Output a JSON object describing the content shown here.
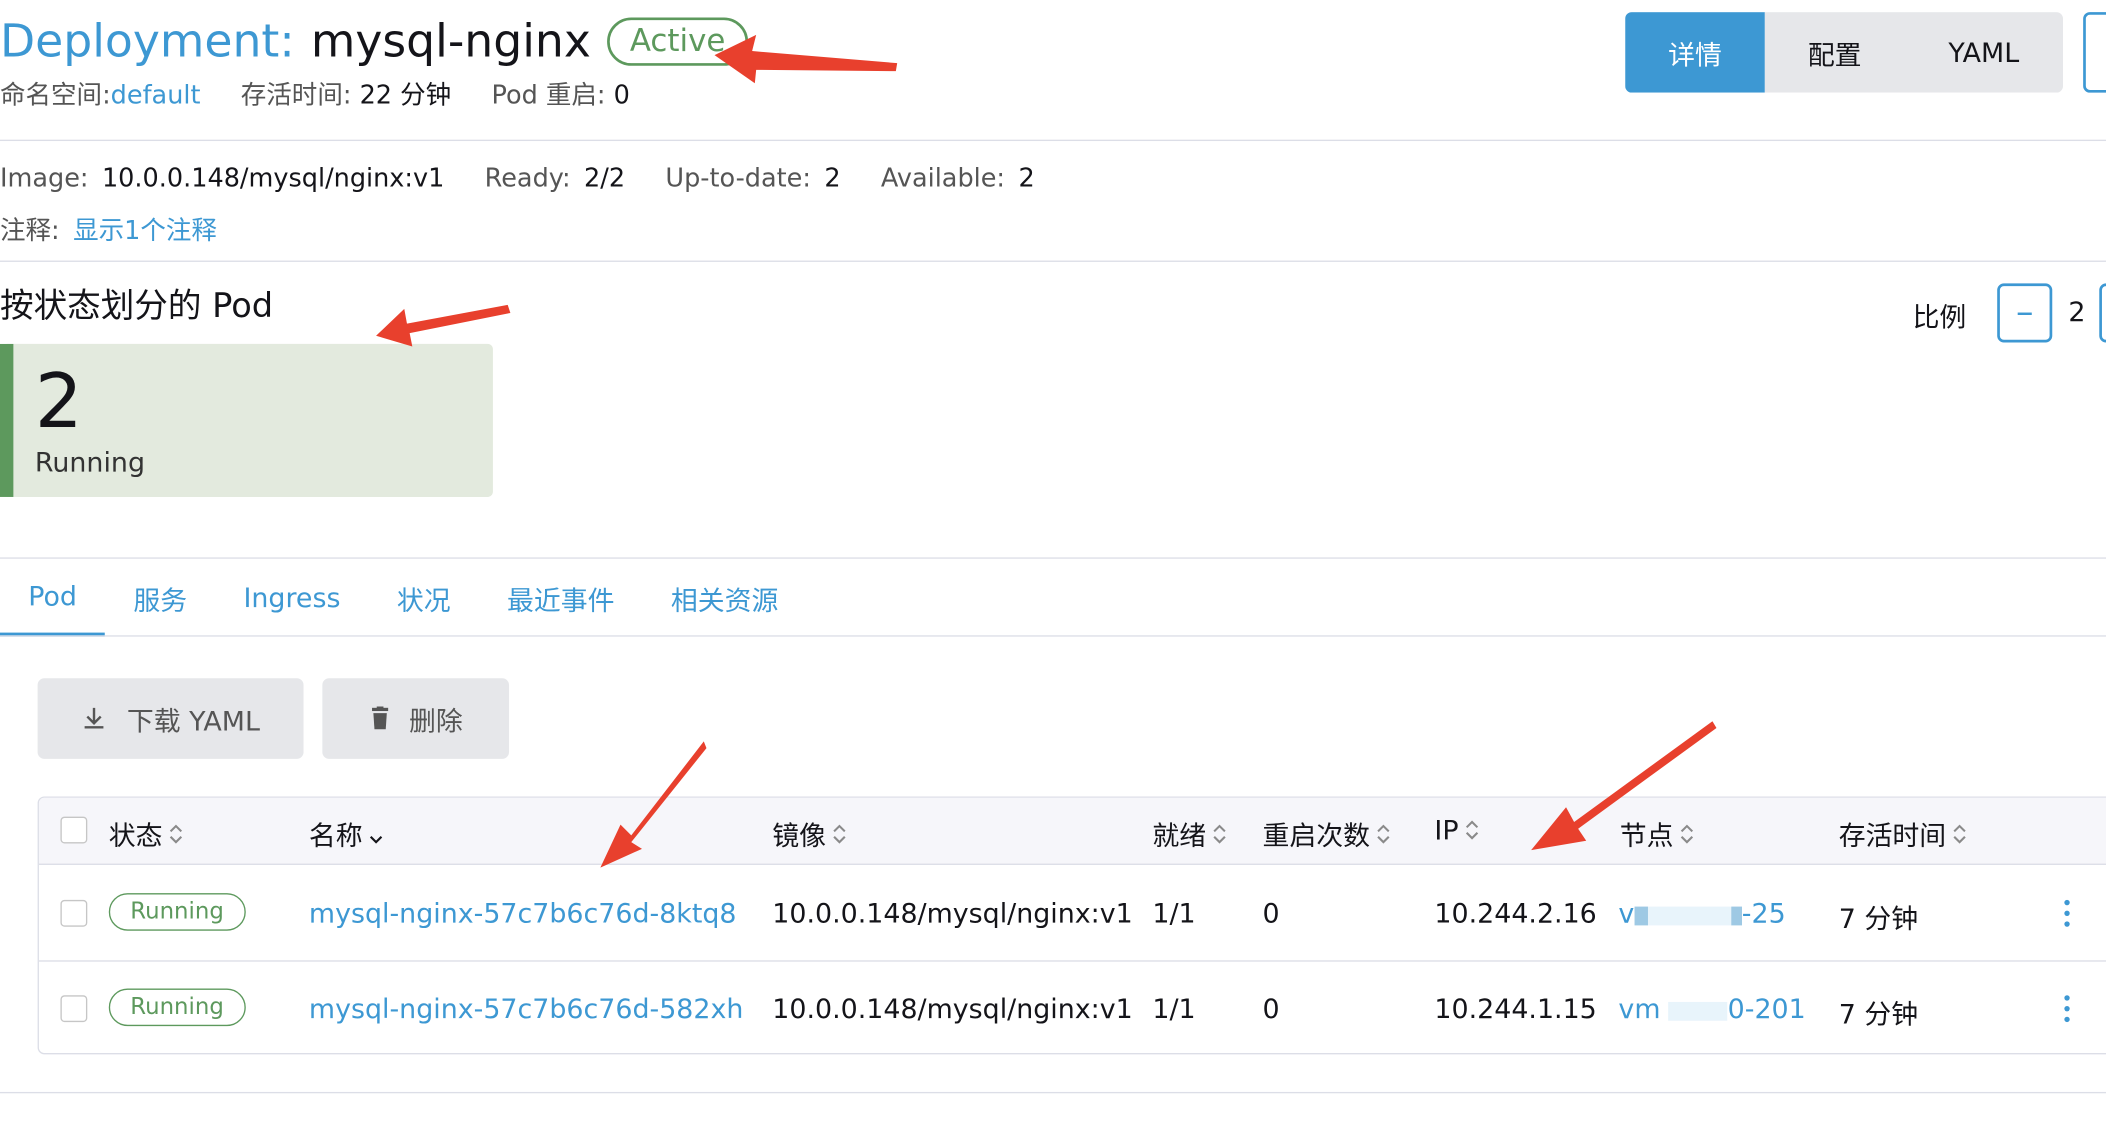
{
  "header": {
    "type_label": "Deployment:",
    "name": "mysql-nginx",
    "state": "Active",
    "namespace_label": "命名空间:",
    "namespace": "default",
    "age_label": "存活时间:",
    "age": "22 分钟",
    "restarts_label": "Pod 重启:",
    "restarts": "0"
  },
  "view_switch": [
    "详情",
    "配置",
    "YAML"
  ],
  "details": {
    "image_label": "Image:",
    "image": "10.0.0.148/mysql/nginx:v1",
    "ready_label": "Ready:",
    "ready": "2/2",
    "uptodate_label": "Up-to-date:",
    "uptodate": "2",
    "available_label": "Available:",
    "available": "2",
    "annotation_label": "注释:",
    "annotation_link": "显示1个注释"
  },
  "pods_by_state": {
    "title": "按状态划分的 Pod",
    "scale_label": "比例",
    "scale_minus": "–",
    "scale_value": "2",
    "count": "2",
    "state": "Running"
  },
  "tabs": [
    "Pod",
    "服务",
    "Ingress",
    "状况",
    "最近事件",
    "相关资源"
  ],
  "toolbar": {
    "download_label": "下载 YAML",
    "delete_label": "删除"
  },
  "table": {
    "headers": [
      "状态",
      "名称",
      "镜像",
      "就绪",
      "重启次数",
      "IP",
      "节点",
      "存活时间"
    ],
    "rows": [
      {
        "status": "Running",
        "name": "mysql-nginx-57c7b6c76d-8ktq8",
        "image": "10.0.0.148/mysql/nginx:v1",
        "ready": "1/1",
        "restarts": "0",
        "ip": "10.244.2.16",
        "node_prefix": "v",
        "node_suffix": "-25",
        "age": "7 分钟"
      },
      {
        "status": "Running",
        "name": "mysql-nginx-57c7b6c76d-582xh",
        "image": "10.0.0.148/mysql/nginx:v1",
        "ready": "1/1",
        "restarts": "0",
        "ip": "10.244.1.15",
        "node_prefix": "vm",
        "node_suffix": "0-201",
        "age": "7 分钟"
      }
    ]
  },
  "colors": {
    "accent": "#3d98d3",
    "success": "#5d995d",
    "annotation_arrow": "#e8402d"
  },
  "icons": [
    "download-icon",
    "trash-icon",
    "sort-icon",
    "kebab-icon",
    "arrow-annotation"
  ]
}
